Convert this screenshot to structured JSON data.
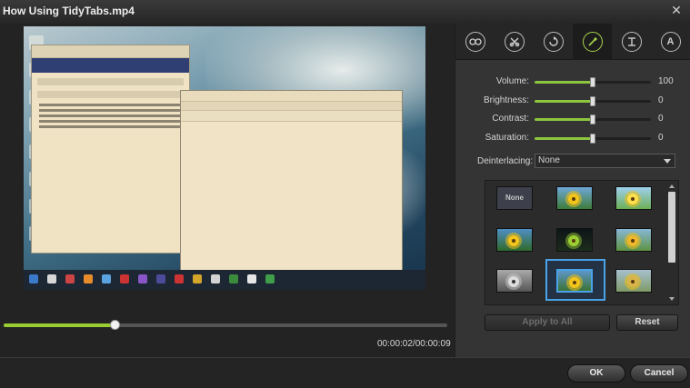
{
  "window": {
    "title": "How Using TidyTabs.mp4",
    "close_icon": "close-x-icon"
  },
  "player": {
    "timecode": "00:00:02/00:00:09",
    "progress_fraction": 0.25,
    "controls": [
      "skip-back-icon",
      "step-back-icon",
      "play-icon",
      "step-forward-icon",
      "skip-forward-icon",
      "camera-icon"
    ]
  },
  "tabs": [
    {
      "icon": "effects-icon",
      "active": false
    },
    {
      "icon": "crop-icon",
      "active": false
    },
    {
      "icon": "rotate-icon",
      "active": false
    },
    {
      "icon": "adjust-magic-icon",
      "active": true
    },
    {
      "icon": "watermark-icon",
      "active": false
    },
    {
      "icon": "text-icon",
      "glyph": "A",
      "active": false
    }
  ],
  "adjust": {
    "sliders": [
      {
        "label": "Volume:",
        "value": "100",
        "fraction": 0.5
      },
      {
        "label": "Brightness:",
        "value": "0",
        "fraction": 0.5
      },
      {
        "label": "Contrast:",
        "value": "0",
        "fraction": 0.5
      },
      {
        "label": "Saturation:",
        "value": "0",
        "fraction": 0.5
      }
    ],
    "deinterlacing_label": "Deinterlacing:",
    "deinterlacing_value": "None",
    "effects": [
      {
        "label": "None",
        "style": "none"
      },
      {
        "style": "normal"
      },
      {
        "style": "bright"
      },
      {
        "style": "normal"
      },
      {
        "style": "dark"
      },
      {
        "style": "warm"
      },
      {
        "style": "grayscale"
      },
      {
        "style": "normal",
        "selected": true
      },
      {
        "style": "faded"
      }
    ],
    "apply_all_label": "Apply to All",
    "reset_label": "Reset"
  },
  "footer": {
    "ok_label": "OK",
    "cancel_label": "Cancel"
  },
  "colors": {
    "accent_green": "#8cc63f",
    "selection_blue": "#4aa3e8"
  }
}
